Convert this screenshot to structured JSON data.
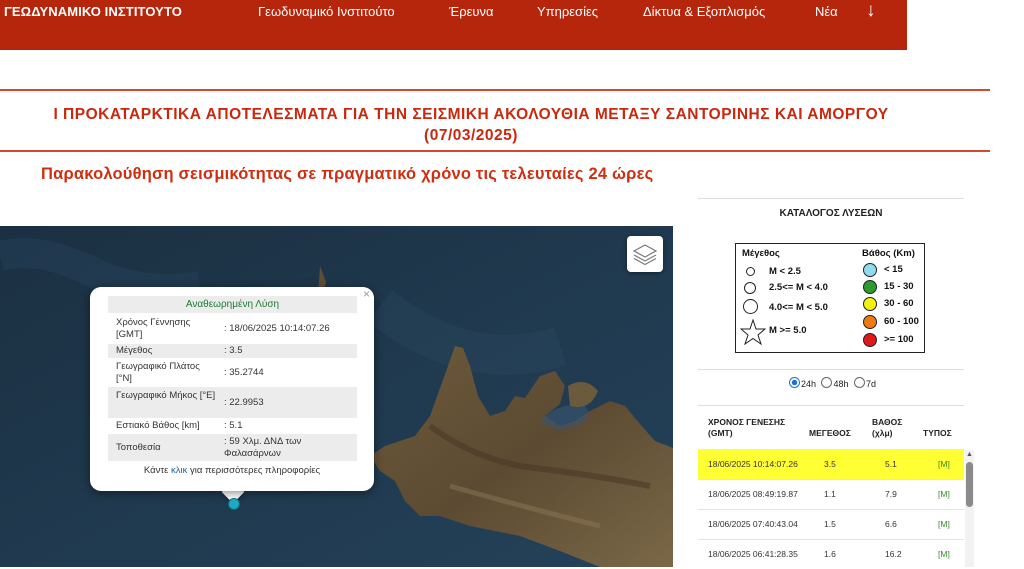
{
  "header": {
    "brand": "ΓΕΩΔΥΝΑΜΙΚΟ ΙΝΣΤΙΤΟΥΤΟ",
    "nav": [
      "Γεωδυναμικό Ινστιτούτο",
      "Έρευνα",
      "Υπηρεσίες",
      "Δίκτυα & Εξοπλισμός",
      "Νέα"
    ],
    "nav_arrow": "↓",
    "color": "#b5260c"
  },
  "page": {
    "title_line1": "Ι ΠΡΟΚΑΤΑΡΚΤΙΚΑ ΑΠΟΤΕΛΕΣΜΑΤΑ ΓΙΑ ΤΗΝ ΣΕΙΣΜΙΚΗ ΑΚΟΛΟΥΘΙΑ ΜΕΤΑΞΥ ΣΑΝΤΟΡΙΝΗΣ ΚΑΙ ΑΜΟΡΓΟΥ",
    "title_line2": "(07/03/2025)",
    "subtitle": "Παρακολούθηση σεισμικότητας σε πραγματικό χρόνο τις τελευταίες 24 ώρες"
  },
  "map": {
    "layers_icon": "layers-icon",
    "popup": {
      "close": "×",
      "header": "Αναθεωρημένη Λύση",
      "rows": [
        {
          "key": "Χρόνος Γέννησης [GMT]",
          "value": ": 18/06/2025 10:14:07.26"
        },
        {
          "key": "Μέγεθος",
          "value": ": 3.5"
        },
        {
          "key": "Γεωγραφικό Πλάτος [°N]",
          "value": ": 35.2744"
        },
        {
          "key": "Γεωγραφικό Μήκος [°E]",
          "value": ": 22.9953"
        },
        {
          "key": "Εστιακό Βάθος [km]",
          "value": ": 5.1"
        },
        {
          "key": "Τοποθεσία",
          "value": ": 59 Χλμ. ΔΝΔ των Φαλασάρνων"
        }
      ],
      "footer_prefix": "Κάντε ",
      "footer_link": "κλικ",
      "footer_suffix": " για περισσότερες πληροφορίες"
    }
  },
  "panel": {
    "title": "ΚΑΤΑΛΟΓΟΣ ΛΥΣΕΩΝ",
    "legend": {
      "magnitude_title": "Μέγεθος",
      "magnitudes": [
        "M < 2.5",
        "2.5<= M < 4.0",
        "4.0<= M < 5.0",
        "M >= 5.0"
      ],
      "depth_title": "Βάθος (Km)",
      "depths": [
        {
          "label": "< 15",
          "color": "#8fdcef"
        },
        {
          "label": "15 - 30",
          "color": "#2c9a2c"
        },
        {
          "label": "30 - 60",
          "color": "#f2f20a"
        },
        {
          "label": "60 - 100",
          "color": "#f07a12"
        },
        {
          "label": ">= 100",
          "color": "#e0181c"
        }
      ]
    },
    "time_options": [
      {
        "label": "24h",
        "selected": true
      },
      {
        "label": "48h",
        "selected": false
      },
      {
        "label": "7d",
        "selected": false
      }
    ],
    "table": {
      "headers": {
        "time": "ΧΡΟΝΟΣ ΓΕΝΕΣΗΣ (GMT)",
        "mag": "ΜΕΓΕΘΟΣ",
        "depth": "ΒΑΘΟΣ (χλμ)",
        "type": "ΤΥΠΟΣ"
      },
      "rows": [
        {
          "time": "18/06/2025 10:14:07.26",
          "mag": "3.5",
          "depth": "5.1",
          "type": "[M]",
          "highlight": true
        },
        {
          "time": "18/06/2025 08:49:19.87",
          "mag": "1.1",
          "depth": "7.9",
          "type": "[M]",
          "highlight": false
        },
        {
          "time": "18/06/2025 07:40:43.04",
          "mag": "1.5",
          "depth": "6.6",
          "type": "[M]",
          "highlight": false
        },
        {
          "time": "18/06/2025 06:41:28.35",
          "mag": "1.6",
          "depth": "16.2",
          "type": "[M]",
          "highlight": false
        }
      ]
    }
  }
}
